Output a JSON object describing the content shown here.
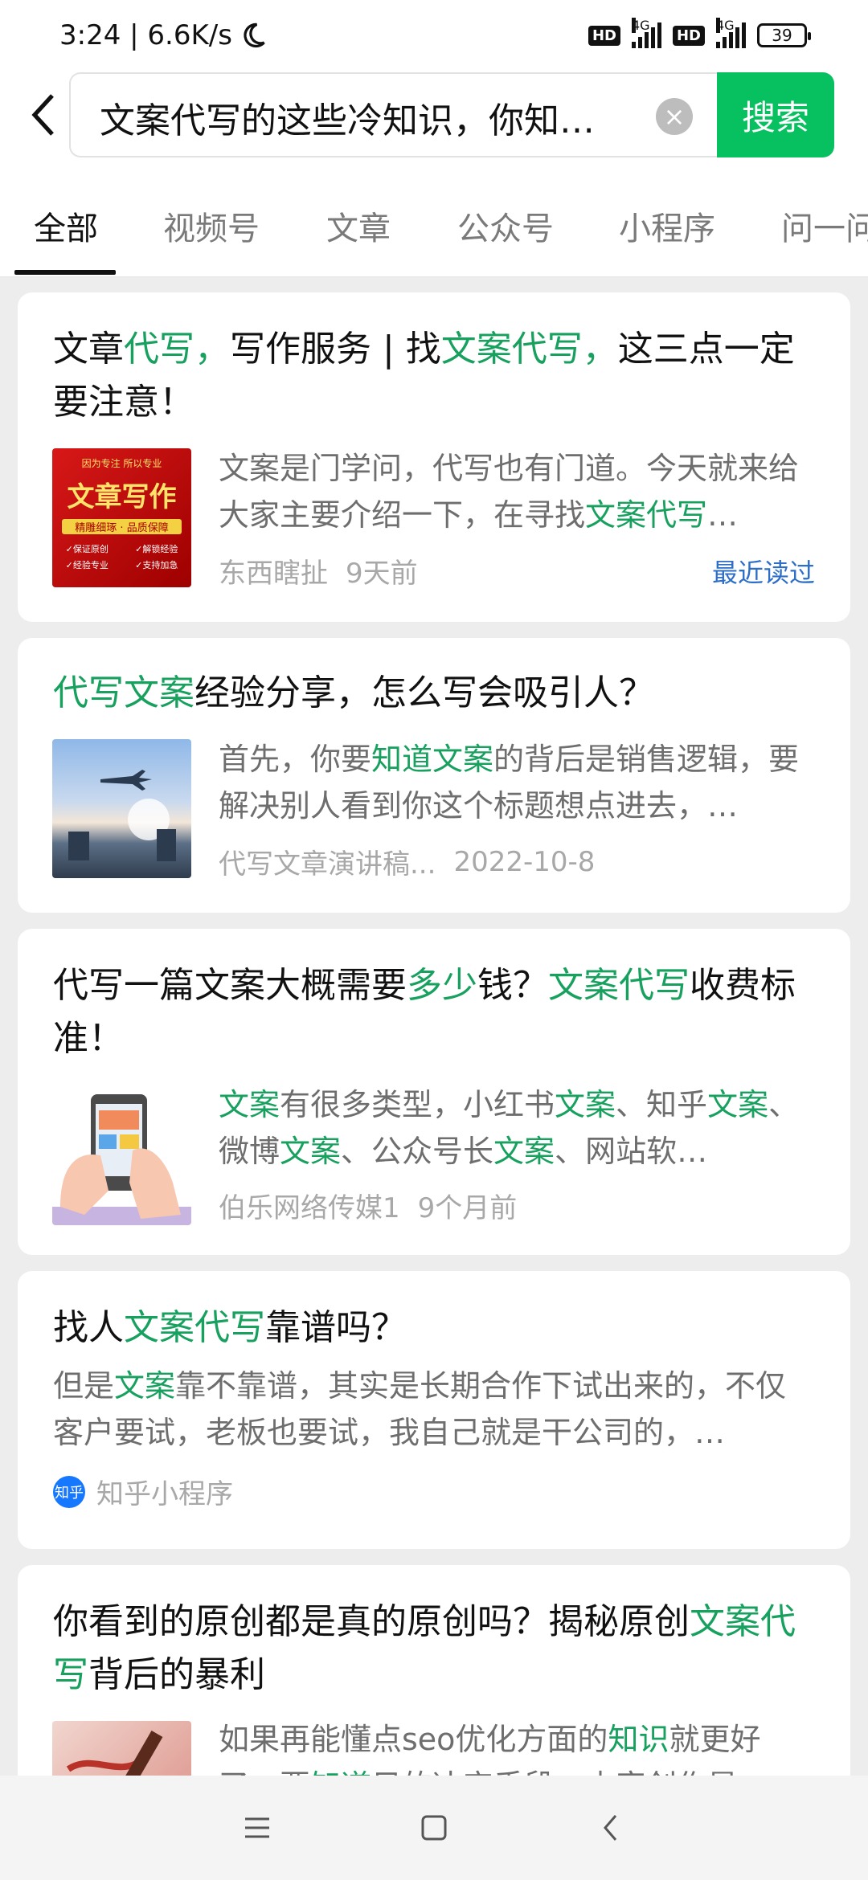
{
  "status": {
    "time": "3:24 | 6.6K/s",
    "hd": "HD",
    "network": "4G",
    "battery": "39"
  },
  "search": {
    "query": "文案代写的这些冷知识，你知…",
    "button": "搜索"
  },
  "tabs": [
    "全部",
    "视频号",
    "文章",
    "公众号",
    "小程序",
    "问一问"
  ],
  "results": [
    {
      "title": [
        "文章",
        "代写，",
        "写作服务 | 找",
        "文案代写，",
        "这三点一定要注意！"
      ],
      "thumb_text": {
        "top": "因为专注 所以专业",
        "main": "文章写作",
        "sub": "精雕细琢 · 品质保障",
        "b1": "✓保证原创",
        "b2": "✓解锁经验",
        "b3": "✓经验专业",
        "b4": "✓支持加急"
      },
      "snippet": [
        "文案是门学问，代写也有门道。今天就来给大家主要介绍一下，在寻找",
        "文案代写",
        "…"
      ],
      "source": "东西瞎扯",
      "time": "9天前",
      "tag": "最近读过"
    },
    {
      "title": [
        "代写文案",
        "经验分享，怎么写会吸引人？"
      ],
      "snippet": [
        "首先，你要",
        "知道文案",
        "的背后是销售逻辑，要解决别人看到你这个标题想点进去，…"
      ],
      "source": "代写文章演讲稿...",
      "time": "2022-10-8"
    },
    {
      "title": [
        "代写一篇文案大概需要",
        "多少",
        "钱？",
        "文案代写",
        "收费标准！"
      ],
      "snippet": [
        "文案",
        "有很多类型，小红书",
        "文案",
        "、知乎",
        "文案",
        "、微博",
        "文案",
        "、公众号长",
        "文案",
        "、网站软…"
      ],
      "source": "伯乐网络传媒1",
      "time": "9个月前"
    },
    {
      "title": [
        "找人",
        "文案代写",
        "靠谱吗？"
      ],
      "snippet": [
        "但是",
        "文案",
        "靠不靠谱，其实是长期合作下试出来的，不仅客户要试，老板也要试，我自己就是干公司的，…"
      ],
      "logo": "知乎",
      "source": "知乎小程序"
    },
    {
      "title": [
        "你看到的原创都是真的原创吗？揭秘原创",
        "文案代写",
        "背后的暴利"
      ],
      "snippet": [
        "如果再能懂点seo优化方面的",
        "知识",
        "就更好了，要",
        "知道",
        "目的决定手段，内容创作是…"
      ]
    }
  ],
  "colors": {
    "accent": "#07c160",
    "highlight": "#17a05e",
    "link": "#2c6ec8"
  }
}
